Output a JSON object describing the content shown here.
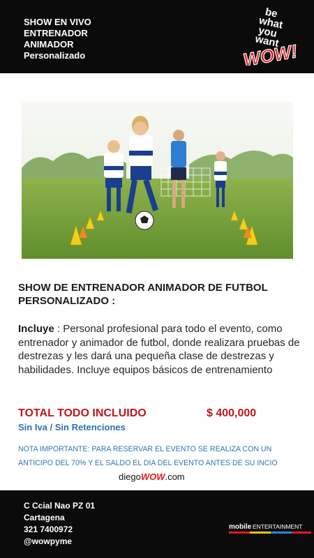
{
  "header": {
    "lines": [
      "SHOW EN VIVO",
      "ENTRENADOR",
      "ANIMADOR",
      "Personalizado"
    ],
    "logo_text": [
      "be",
      "what",
      "you",
      "want",
      "WOW!"
    ]
  },
  "photo": {
    "icon": "soccer-training-photo"
  },
  "content": {
    "title_line1": "SHOW DE ENTRENADOR  ANIMADOR DE FUTBOL",
    "title_line2": "PERSONALIZADO  :",
    "includes_label": "Incluye",
    "description": " : Personal profesional para todo el evento, como entrenador y animador de futbol, donde realizara pruebas de destrezas y les dará una pequeña clase de destrezas y habilidades.  Incluye equipos básicos de entrenamiento",
    "total_label": "TOTAL TODO INCLUIDO",
    "total_price": "$ 400,000",
    "tax_note": "Sin Iva / Sin Retenciones",
    "note_line1": "NOTA IMPORTANTE: PARA RESERVAR EL  EVENTO SE REALIZA CON UN",
    "note_line2": "ANTICIPO DEL 70% Y EL SALDO EL DIA DEL EVENTO ANTES DE SU INCIO",
    "brand_prefix": "diego",
    "brand_wow": "WOW",
    "brand_suffix": ".com"
  },
  "footer": {
    "lines": [
      "C Ccial Nao PZ 01",
      "Cartagena",
      "321 7400972",
      "@wowpyme"
    ],
    "partner_bold": "mobile",
    "partner_rest": "ENTERTAINMENT"
  },
  "colors": {
    "accent_red": "#c0161b",
    "accent_blue": "#2e75b6",
    "bar_black": "#0b0b0b"
  }
}
